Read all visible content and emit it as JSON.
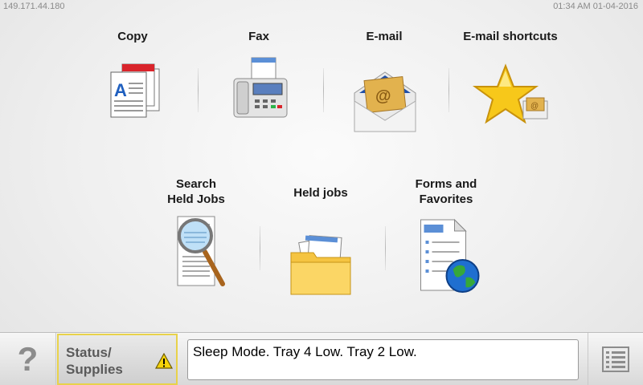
{
  "header": {
    "ip_address": "149.171.44.180",
    "datetime": "01:34 AM 01-04-2016"
  },
  "tiles": [
    {
      "label": "Copy",
      "icon": "copy-icon"
    },
    {
      "label": "Fax",
      "icon": "fax-icon"
    },
    {
      "label": "E-mail",
      "icon": "email-icon"
    },
    {
      "label": "E-mail shortcuts",
      "icon": "email-shortcuts-icon"
    },
    {
      "label_line1": "Search",
      "label_line2": "Held Jobs",
      "icon": "search-held-jobs-icon"
    },
    {
      "label": "Held jobs",
      "icon": "held-jobs-folder-icon"
    },
    {
      "label_line1": "Forms and",
      "label_line2": "Favorites",
      "icon": "forms-favorites-icon"
    }
  ],
  "bottom": {
    "help_label": "?",
    "status_line1": "Status/",
    "status_line2": "Supplies",
    "message": "Sleep Mode. Tray 4 Low. Tray 2 Low.",
    "warning_icon": "warning-icon",
    "menu_icon": "menu-list-icon"
  },
  "colors": {
    "status_border": "#e8d24a",
    "warning_yellow": "#f5d20a",
    "accent_blue": "#1f5fbf"
  }
}
